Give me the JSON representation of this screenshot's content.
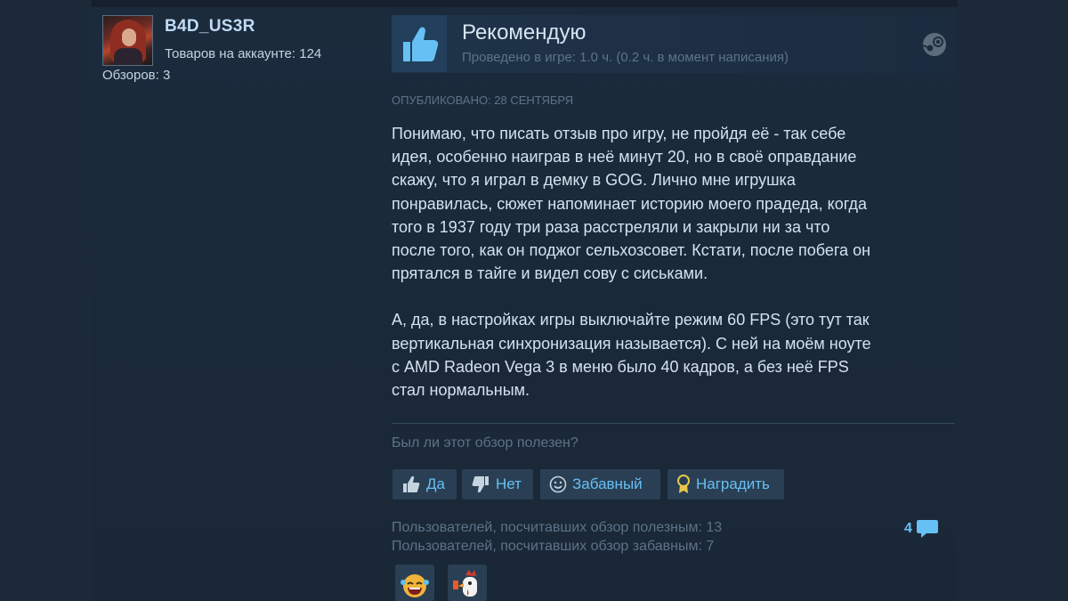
{
  "user": {
    "name": "B4D_US3R",
    "products": "Товаров на аккаунте: 124",
    "reviews": "Обзоров: 3"
  },
  "review": {
    "verdict": "Рекомендую",
    "playtime": "Проведено в игре: 1.0 ч. (0.2 ч. в момент написания)",
    "posted": "Опубликовано: 28 сентября",
    "paragraph1_lines": [
      "Понимаю, что писать отзыв про игру, не пройдя её - так себе",
      "идея, особенно наиграв в неё минут 20, но в своё оправдание",
      "скажу, что я играл в демку в GOG. Лично мне игрушка",
      "понравилась, сюжет напоминает историю моего прадеда, когда",
      "того в 1937 году три раза расстреляли и закрыли ни за что",
      "после того, как он поджог сельхозсовет. Кстати, после побега он",
      "прятался в тайге и видел сову с сиськами."
    ],
    "paragraph2_lines": [
      "А, да, в настройках игры выключайте режим 60 FPS (это тут так",
      "вертикальная синхронизация называется). С ней на моём ноуте",
      "с AMD Radeon Vega 3 в меню было 40 кадров, а без неё FPS",
      "стал нормальным."
    ]
  },
  "feedback": {
    "question": "Был ли этот обзор полезен?",
    "yes_label": "Да",
    "no_label": "Нет",
    "funny_label": "Забавный",
    "award_label": "Наградить",
    "helpful_count": "Пользователей, посчитавших обзор полезным: 13",
    "funny_count": "Пользователей, посчитавших обзор забавным: 7",
    "comments_count": "4"
  },
  "icons": {
    "thumb": "thumbs-up-icon",
    "platform": "steam-icon",
    "comments": "speech-bubble-icon"
  },
  "colors": {
    "link": "#66c0f4",
    "username": "#c1dbf4",
    "muted": "#5d7387"
  }
}
